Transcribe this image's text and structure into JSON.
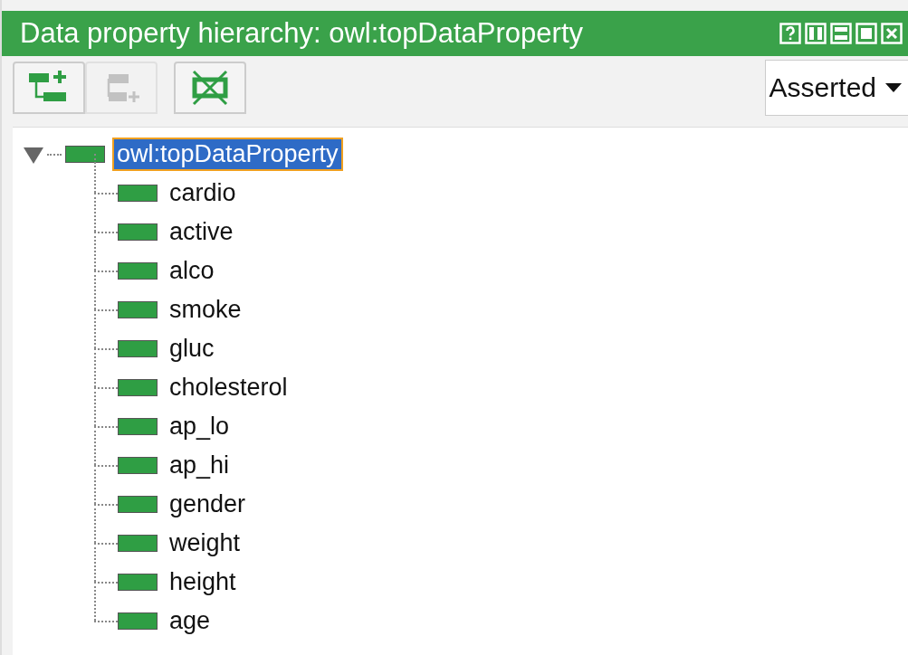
{
  "window": {
    "title": "Data property hierarchy: owl:topDataProperty"
  },
  "toolbar": {
    "buttons": [
      {
        "kind": "add-sub",
        "disabled": false
      },
      {
        "kind": "add-sibling",
        "disabled": true
      },
      {
        "kind": "delete",
        "disabled": false
      }
    ],
    "mode": "Asserted"
  },
  "tree": [
    {
      "label": "owl:topDataProperty",
      "selected": true,
      "expanded": true,
      "children": [
        {
          "label": "cardio",
          "selected": false
        },
        {
          "label": "active",
          "selected": false
        },
        {
          "label": "alco",
          "selected": false
        },
        {
          "label": "smoke",
          "selected": false
        },
        {
          "label": "gluc",
          "selected": false
        },
        {
          "label": "cholesterol",
          "selected": false
        },
        {
          "label": "ap_lo",
          "selected": false
        },
        {
          "label": "ap_hi",
          "selected": false
        },
        {
          "label": "gender",
          "selected": false
        },
        {
          "label": "weight",
          "selected": false
        },
        {
          "label": "height",
          "selected": false
        },
        {
          "label": "age",
          "selected": false
        }
      ]
    }
  ]
}
